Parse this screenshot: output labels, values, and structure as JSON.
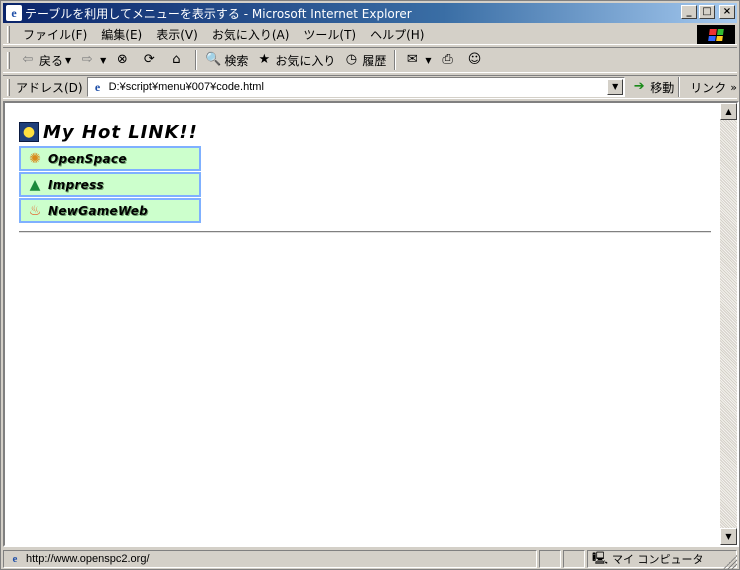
{
  "window": {
    "title": "テーブルを利用してメニューを表示する - Microsoft Internet Explorer",
    "minimize": "_",
    "maximize": "□",
    "close": "×"
  },
  "menubar": {
    "items": [
      "ファイル(F)",
      "編集(E)",
      "表示(V)",
      "お気に入り(A)",
      "ツール(T)",
      "ヘルプ(H)"
    ]
  },
  "toolbar": {
    "back_label": "戻る",
    "search_label": "検索",
    "favorites_label": "お気に入り",
    "history_label": "履歴"
  },
  "address": {
    "label": "アドレス(D)",
    "value": "D:¥script¥menu¥007¥code.html",
    "go_label": "移動",
    "links_label": "リンク"
  },
  "content": {
    "heading": "My Hot LINK!!",
    "links": [
      {
        "label": "OpenSpace",
        "icon": "gear-sun-icon"
      },
      {
        "label": "Impress",
        "icon": "tree-icon"
      },
      {
        "label": "NewGameWeb",
        "icon": "fire-icon"
      }
    ]
  },
  "status": {
    "text": "http://www.openspc2.org/",
    "zone": "マイ コンピュータ"
  },
  "colors": {
    "menu_cell_bg": "#ccffcc",
    "menu_cell_border": "#7fb0ff",
    "titlebar": "#0a246a"
  }
}
